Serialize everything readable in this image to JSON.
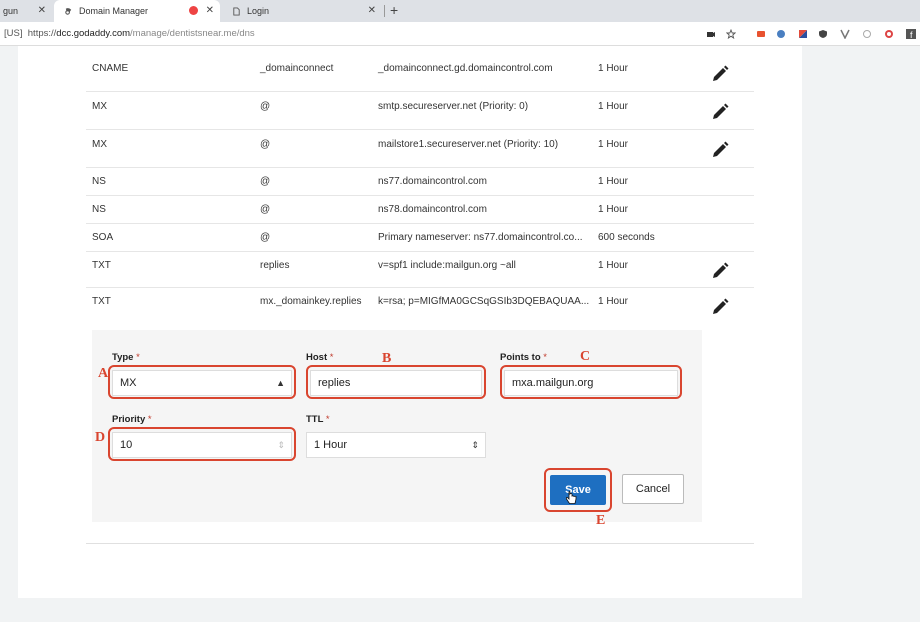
{
  "browser": {
    "tabs": [
      {
        "label": "gun"
      },
      {
        "label": "Domain Manager"
      },
      {
        "label": "Login"
      }
    ],
    "url_prefix": "[US]",
    "url_scheme": "https://",
    "url_host": "dcc.godaddy.com",
    "url_path": "/manage/dentistsnear.me/dns",
    "close_glyph": "✕",
    "new_tab_glyph": "+"
  },
  "dns_records": [
    {
      "type": "CNAME",
      "host": "_domainconnect",
      "points_to": "_domainconnect.gd.domaincontrol.com",
      "ttl": "1 Hour",
      "editable": true
    },
    {
      "type": "MX",
      "host": "@",
      "points_to": "smtp.secureserver.net (Priority: 0)",
      "ttl": "1 Hour",
      "editable": true
    },
    {
      "type": "MX",
      "host": "@",
      "points_to": "mailstore1.secureserver.net (Priority: 10)",
      "ttl": "1 Hour",
      "editable": true
    },
    {
      "type": "NS",
      "host": "@",
      "points_to": "ns77.domaincontrol.com",
      "ttl": "1 Hour",
      "editable": false
    },
    {
      "type": "NS",
      "host": "@",
      "points_to": "ns78.domaincontrol.com",
      "ttl": "1 Hour",
      "editable": false
    },
    {
      "type": "SOA",
      "host": "@",
      "points_to": "Primary nameserver: ns77.domaincontrol.co...",
      "ttl": "600 seconds",
      "editable": false
    },
    {
      "type": "TXT",
      "host": "replies",
      "points_to": "v=spf1 include:mailgun.org ~all",
      "ttl": "1 Hour",
      "editable": true
    },
    {
      "type": "TXT",
      "host": "mx._domainkey.replies",
      "points_to": "k=rsa; p=MIGfMA0GCSqGSIb3DQEBAQUAA...",
      "ttl": "1 Hour",
      "editable": true
    }
  ],
  "form": {
    "required_mark": "*",
    "type_label": "Type",
    "type_value": "MX",
    "host_label": "Host",
    "host_value": "replies",
    "points_label": "Points to",
    "points_value": "mxa.mailgun.org",
    "priority_label": "Priority",
    "priority_value": "10",
    "ttl_label": "TTL",
    "ttl_value": "1 Hour",
    "save_label": "Save",
    "cancel_label": "Cancel"
  },
  "annotations": {
    "a": "A",
    "b": "B",
    "c": "C",
    "d": "D",
    "e": "E",
    "color": "#d9452f"
  },
  "colors": {
    "save_button": "#1e6fc1",
    "highlight": "#d9452f",
    "form_panel": "#f5f5f5"
  }
}
